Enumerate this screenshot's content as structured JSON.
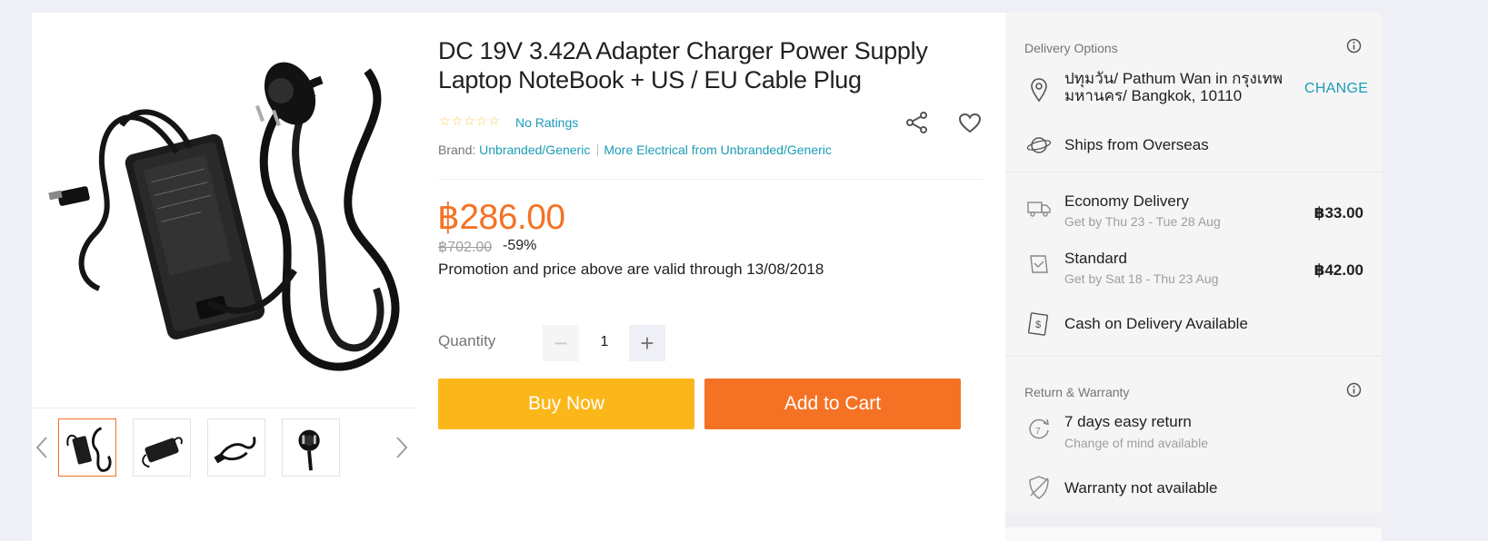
{
  "product": {
    "title_line1": "DC 19V 3.42A Adapter Charger Power Supply",
    "title_line2": "Laptop NoteBook + US / EU Cable Plug",
    "ratings_label": "No Ratings",
    "brand_prefix": "Brand:",
    "brand_name": "Unbranded/Generic",
    "more_from": "More Electrical from Unbranded/Generic",
    "price": "฿286.00",
    "original_price": "฿702.00",
    "discount": "-59%",
    "promo_note": "Promotion and price above are valid through 13/08/2018",
    "star_rating": 0
  },
  "quantity": {
    "label": "Quantity",
    "value": "1",
    "minus": "−",
    "plus": "+"
  },
  "actions": {
    "buy_now": "Buy Now",
    "add_to_cart": "Add to Cart"
  },
  "delivery": {
    "title": "Delivery Options",
    "location": "ปทุมวัน/ Pathum Wan in กรุงเทพมหานคร/ Bangkok, 10110",
    "location_line1": "ปทุมวัน/ Pathum Wan in กรุงเทพ",
    "location_line2": "มหานคร/ Bangkok, 10110",
    "change_label": "CHANGE",
    "ships_from": "Ships from Overseas",
    "options": [
      {
        "name": "Economy Delivery",
        "eta": "Get by Thu 23 - Tue 28 Aug",
        "price": "฿33.00"
      },
      {
        "name": "Standard",
        "eta": "Get by Sat 18 - Thu 23 Aug",
        "price": "฿42.00"
      }
    ],
    "cod": "Cash on Delivery Available"
  },
  "warranty": {
    "title": "Return & Warranty",
    "return_title": "7 days easy return",
    "return_sub": "Change of mind available",
    "warranty_text": "Warranty not available"
  },
  "colors": {
    "accent_orange": "#f57224",
    "buy_yellow": "#fbb71a",
    "link_blue": "#1a9cb7"
  }
}
